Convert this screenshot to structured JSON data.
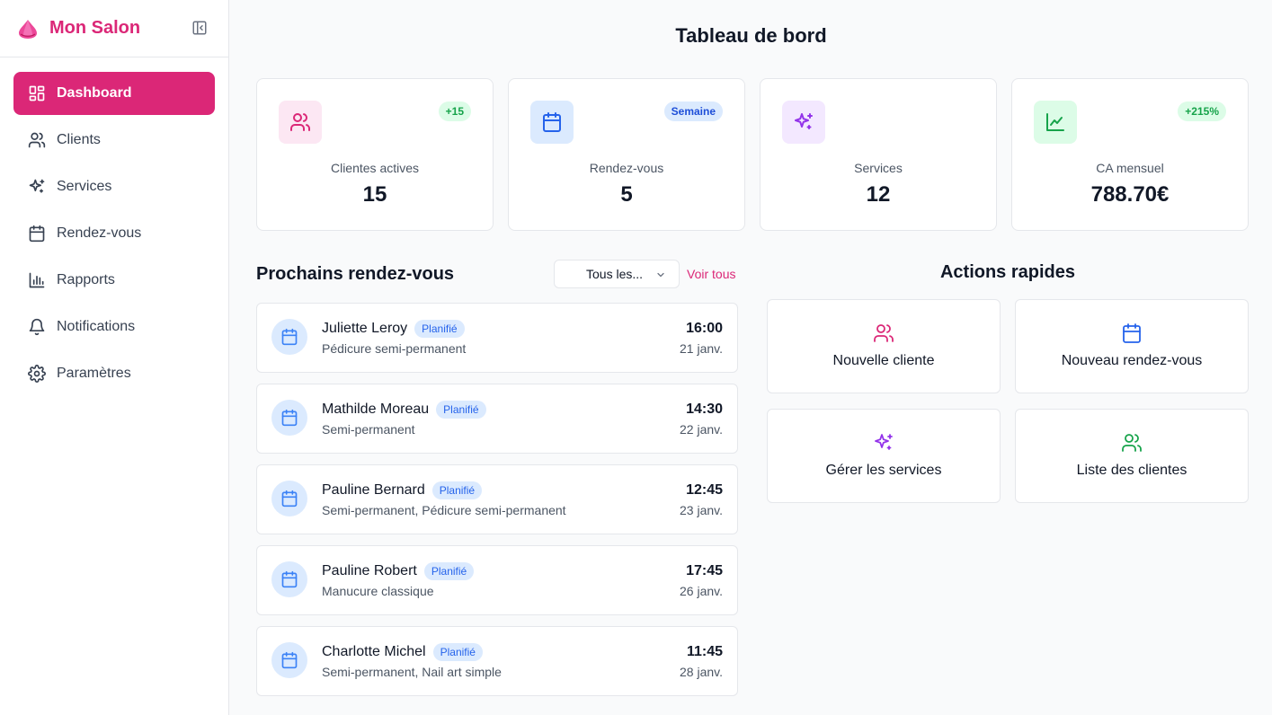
{
  "sidebar": {
    "brand": "Mon Salon",
    "items": [
      {
        "label": "Dashboard",
        "icon": "dashboard-icon"
      },
      {
        "label": "Clients",
        "icon": "users-icon"
      },
      {
        "label": "Services",
        "icon": "sparkles-icon"
      },
      {
        "label": "Rendez-vous",
        "icon": "calendar-icon"
      },
      {
        "label": "Rapports",
        "icon": "bar-chart-icon"
      },
      {
        "label": "Notifications",
        "icon": "bell-icon"
      },
      {
        "label": "Paramètres",
        "icon": "gear-icon"
      }
    ],
    "active_item": "Dashboard"
  },
  "main": {
    "title": "Tableau de bord",
    "stats": [
      {
        "label": "Clientes actives",
        "value": "15",
        "badge": "+15",
        "icon": "users-icon"
      },
      {
        "label": "Rendez-vous",
        "value": "5",
        "badge": "Semaine",
        "icon": "calendar-icon"
      },
      {
        "label": "Services",
        "value": "12",
        "badge": "",
        "icon": "sparkles-icon"
      },
      {
        "label": "CA mensuel",
        "value": "788.70€",
        "badge": "+215%",
        "icon": "line-chart-icon"
      }
    ],
    "appointments": {
      "title": "Prochains rendez-vous",
      "filter_value": "Tous les...",
      "see_all": "Voir tous",
      "items": [
        {
          "name": "Juliette Leroy",
          "status": "Planifié",
          "service": "Pédicure semi-permanent",
          "time": "16:00",
          "date": "21 janv."
        },
        {
          "name": "Mathilde Moreau",
          "status": "Planifié",
          "service": "Semi-permanent",
          "time": "14:30",
          "date": "22 janv."
        },
        {
          "name": "Pauline Bernard",
          "status": "Planifié",
          "service": "Semi-permanent, Pédicure semi-permanent",
          "time": "12:45",
          "date": "23 janv."
        },
        {
          "name": "Pauline Robert",
          "status": "Planifié",
          "service": "Manucure classique",
          "time": "17:45",
          "date": "26 janv."
        },
        {
          "name": "Charlotte Michel",
          "status": "Planifié",
          "service": "Semi-permanent, Nail art simple",
          "time": "11:45",
          "date": "28 janv."
        }
      ]
    },
    "quick_actions": {
      "title": "Actions rapides",
      "items": [
        {
          "label": "Nouvelle cliente",
          "icon": "users-icon"
        },
        {
          "label": "Nouveau rendez-vous",
          "icon": "calendar-icon"
        },
        {
          "label": "Gérer les services",
          "icon": "sparkles-icon"
        },
        {
          "label": "Liste des clientes",
          "icon": "users-icon"
        }
      ]
    }
  },
  "colors": {
    "brand": "#db2777",
    "pink_soft": "#fce7f3",
    "blue": "#2563eb",
    "blue_soft": "#dbeafe",
    "purple": "#9333ea",
    "purple_soft": "#f3e8ff",
    "green": "#16a34a",
    "green_soft": "#dcfce7"
  }
}
